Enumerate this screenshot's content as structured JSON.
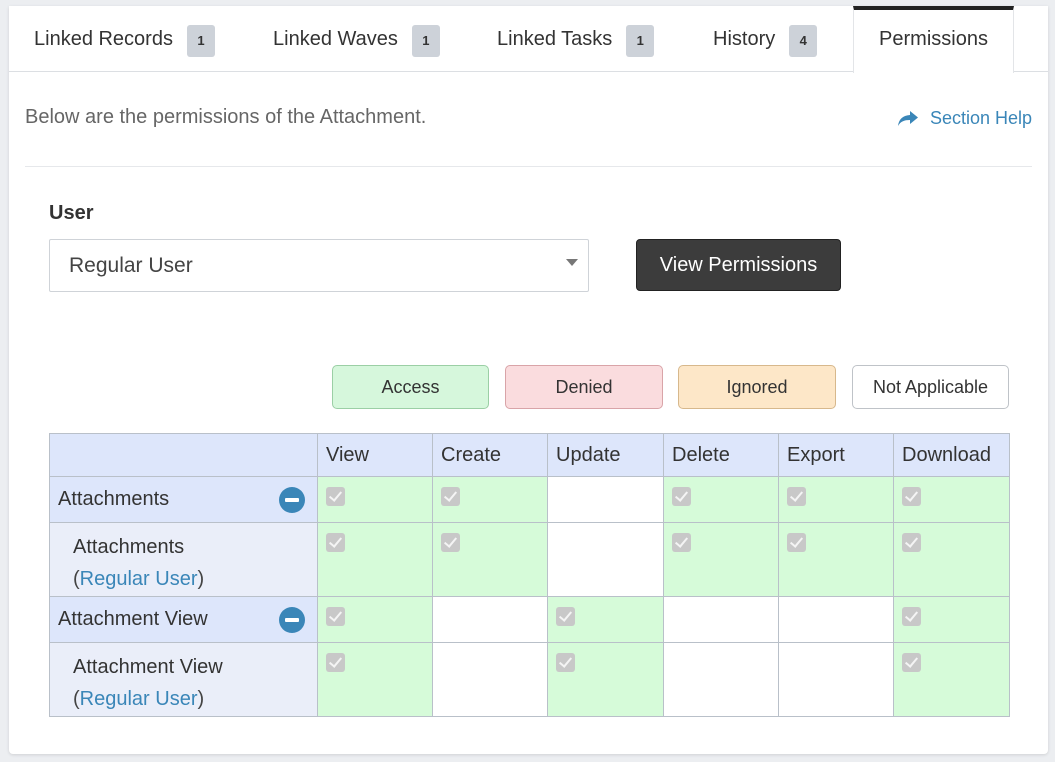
{
  "tabs": [
    {
      "label": "Linked Records",
      "badge": "1"
    },
    {
      "label": "Linked Waves",
      "badge": "1"
    },
    {
      "label": "Linked Tasks",
      "badge": "1"
    },
    {
      "label": "History",
      "badge": "4"
    },
    {
      "label": "Permissions",
      "active": true
    }
  ],
  "description": "Below are the permissions of the Attachment.",
  "section_help": "Section Help",
  "form": {
    "user_label": "User",
    "user_value": "Regular User",
    "view_button": "View Permissions"
  },
  "legend": {
    "access": "Access",
    "denied": "Denied",
    "ignored": "Ignored",
    "not_applicable": "Not Applicable"
  },
  "colors": {
    "access": "#d6fbd9",
    "denied": "#fadcde",
    "ignored": "#fde7c8",
    "header": "#dde6fb",
    "link": "#3a86b8"
  },
  "table": {
    "columns": [
      "View",
      "Create",
      "Update",
      "Delete",
      "Export",
      "Download"
    ],
    "rows": [
      {
        "label": "Attachments",
        "type": "group",
        "cells": [
          "access",
          "access",
          "na",
          "access",
          "access",
          "access"
        ]
      },
      {
        "label": "Attachments",
        "user": "Regular User",
        "type": "item",
        "cells": [
          "access",
          "access",
          "na",
          "access",
          "access",
          "access"
        ]
      },
      {
        "label": "Attachment View",
        "type": "group",
        "cells": [
          "access",
          "na",
          "access",
          "na",
          "na",
          "access"
        ]
      },
      {
        "label": "Attachment View",
        "user": "Regular User",
        "type": "item",
        "cells": [
          "access",
          "na",
          "access",
          "na",
          "na",
          "access"
        ]
      }
    ]
  }
}
